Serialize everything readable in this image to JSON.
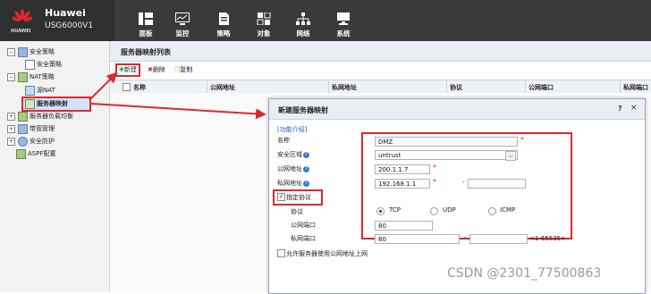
{
  "brand": {
    "name": "Huawei",
    "model": "USG6000V1",
    "logo_text": "HUAWEI"
  },
  "nav": [
    {
      "icon": "dashboard-icon",
      "label": "面板"
    },
    {
      "icon": "monitor-icon",
      "label": "监控"
    },
    {
      "icon": "policy-icon",
      "label": "策略"
    },
    {
      "icon": "object-icon",
      "label": "对象"
    },
    {
      "icon": "network-icon",
      "label": "网络"
    },
    {
      "icon": "system-icon",
      "label": "系统"
    }
  ],
  "sidebar": {
    "items": [
      {
        "label": "安全策略",
        "toggle": "⊟"
      },
      {
        "label": "安全策略",
        "toggle": ""
      },
      {
        "label": "NAT策略",
        "toggle": "⊟"
      },
      {
        "label": "源NAT",
        "toggle": ""
      },
      {
        "label": "服务器映射",
        "toggle": ""
      },
      {
        "label": "服务器负载均衡",
        "toggle": "⊞"
      },
      {
        "label": "带宽管理",
        "toggle": "⊞"
      },
      {
        "label": "安全防护",
        "toggle": "⊞"
      },
      {
        "label": "ASPF配置",
        "toggle": ""
      }
    ]
  },
  "main": {
    "title": "服务器映射列表",
    "toolbar": {
      "new": "新建",
      "delete": "删除",
      "copy": "复制"
    },
    "columns": [
      "名称",
      "公网地址",
      "私网地址",
      "协议",
      "公网端口",
      "私网端口"
    ]
  },
  "dialog": {
    "title": "新建服务器映射",
    "help": "?",
    "close": "×",
    "intro_link": "[功能介绍]",
    "name_label": "名称",
    "name_value": "DMZ",
    "zone_label": "安全区域",
    "zone_value": "untrust",
    "public_label": "公网地址",
    "public_value": "200.1.1.7",
    "private_label": "私网地址",
    "private_value": "192.168.1.1",
    "range_dash": "-",
    "protocol_check_label": "指定协议",
    "protocol_label": "协议",
    "protocol_options": [
      "TCP",
      "UDP",
      "ICMP"
    ],
    "protocol_selected": "TCP",
    "public_port_label": "公网端口",
    "public_port_value": "80",
    "private_port_label": "私网端口",
    "private_port_value": "80",
    "port_hint": "<1-65535>",
    "allow_label": "允许服务器使用公网地址上网",
    "required_mark": "*"
  },
  "watermark": "CSDN @2301_77500863",
  "colors": {
    "topbar": "#3a3a3a",
    "highlight": "#e0262f",
    "header": "#e9eef5"
  }
}
